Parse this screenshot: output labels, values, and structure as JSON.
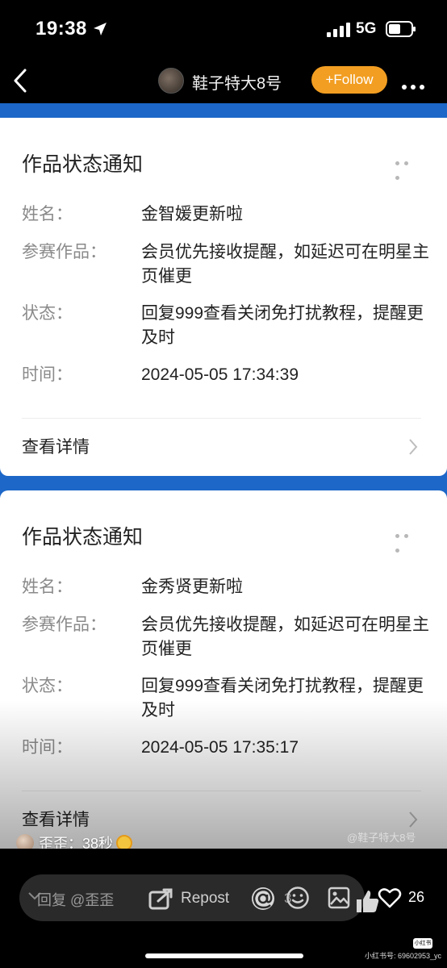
{
  "status_bar": {
    "time": "19:38",
    "network": "5G"
  },
  "nav": {
    "username": "鞋子特大8号",
    "follow_label": "+Follow"
  },
  "cards": [
    {
      "title": "作品状态通知",
      "rows": [
        {
          "label": "姓名：",
          "value": "金智媛更新啦"
        },
        {
          "label": "参赛作品：",
          "value": "会员优先接收提醒，如延迟可在明星主页催更"
        },
        {
          "label": "状态：",
          "value": "回复999查看关闭免打扰教程，提醒更及时"
        },
        {
          "label": "时间：",
          "value": "2024-05-05 17:34:39"
        }
      ],
      "detail_label": "查看详情"
    },
    {
      "title": "作品状态通知",
      "rows": [
        {
          "label": "姓名：",
          "value": "金秀贤更新啦"
        },
        {
          "label": "参赛作品：",
          "value": "会员优先接收提醒，如延迟可在明星主页催更"
        },
        {
          "label": "状态：",
          "value": "回复999查看关闭免打扰教程，提醒更及时"
        },
        {
          "label": "时间：",
          "value": "2024-05-05 17:35:17"
        }
      ],
      "detail_label": "查看详情"
    }
  ],
  "watermark": "@鞋子特大8号",
  "comment": {
    "text": "歪歪：38秒"
  },
  "bottom_bar": {
    "reply_placeholder": "回复 @歪歪",
    "repost_label": "Repost",
    "mention_count": "3",
    "like_count": "26"
  },
  "brand": {
    "logo": "小红书",
    "id": "小红书号: 69602953_yc"
  },
  "colors": {
    "follow": "#f29e22",
    "content_bg": "#1c67c8"
  },
  "icons": [
    "location-arrow-icon",
    "signal-icon",
    "battery-icon",
    "back-icon",
    "more-icon",
    "chevron-right-icon",
    "repost-icon",
    "at-icon",
    "emoji-icon",
    "image-icon",
    "thumbs-up-icon",
    "heart-icon"
  ]
}
